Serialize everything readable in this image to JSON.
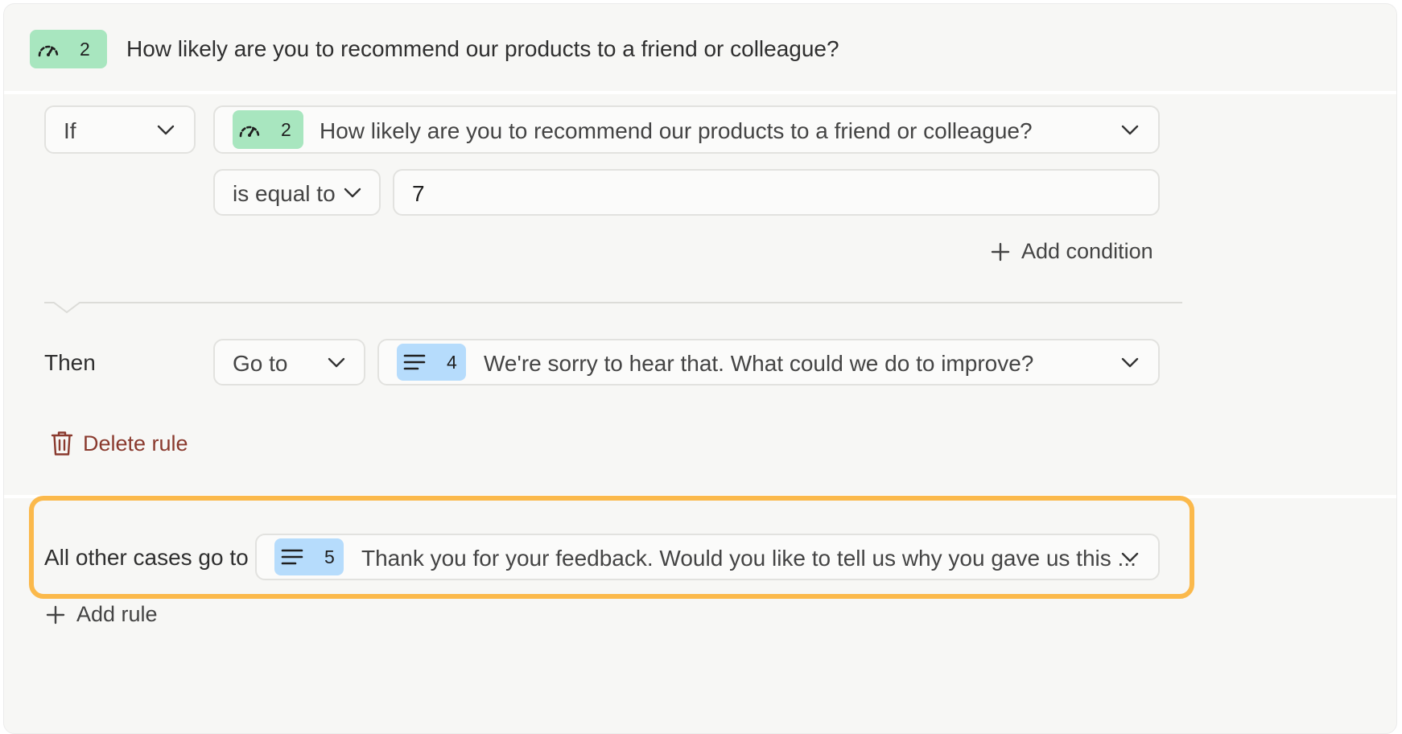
{
  "header": {
    "badge_icon": "gauge-icon",
    "badge_number": "2",
    "badge_color": "#a8e6bf",
    "question": "How likely are you to recommend our products to a friend or colleague?"
  },
  "rule": {
    "if_label": "If",
    "condition_question": {
      "badge_icon": "gauge-icon",
      "badge_number": "2",
      "text": "How likely are you to recommend our products to a friend or colleague?"
    },
    "operator": "is equal to",
    "value": "7",
    "add_condition_label": "Add condition",
    "then_label": "Then",
    "action": "Go to",
    "target": {
      "badge_icon": "text-lines-icon",
      "badge_number": "4",
      "badge_color": "#b6dcfc",
      "text": "We're sorry to hear that. What could we do to improve?"
    },
    "delete_label": "Delete rule",
    "delete_color": "#8a3a2e"
  },
  "fallback": {
    "label": "All other cases go to",
    "target": {
      "badge_icon": "text-lines-icon",
      "badge_number": "5",
      "text": "Thank you for your feedback. Would you like to tell us why you gave us this ..."
    },
    "highlight_color": "#fbb94b"
  },
  "add_rule_label": "Add rule"
}
